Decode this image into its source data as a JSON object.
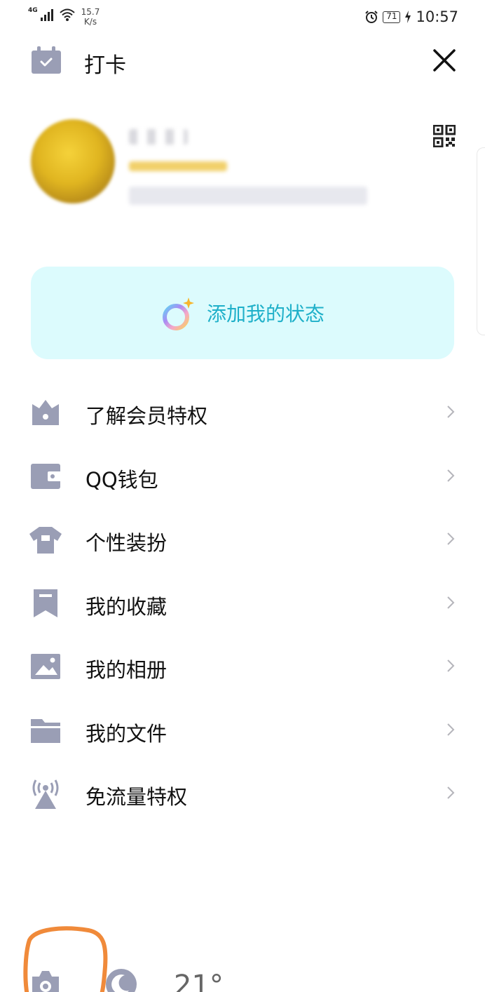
{
  "status_bar": {
    "network": "4G",
    "speed_value": "15.7",
    "speed_unit": "K/s",
    "battery": "71",
    "time": "10:57"
  },
  "header": {
    "title": "打卡"
  },
  "status_card": {
    "label": "添加我的状态"
  },
  "menu": {
    "items": [
      {
        "label": "了解会员特权",
        "icon": "crown-icon"
      },
      {
        "label": "QQ钱包",
        "icon": "wallet-icon"
      },
      {
        "label": "个性装扮",
        "icon": "shirt-icon"
      },
      {
        "label": "我的收藏",
        "icon": "bookmark-icon"
      },
      {
        "label": "我的相册",
        "icon": "photo-icon"
      },
      {
        "label": "我的文件",
        "icon": "folder-icon"
      },
      {
        "label": "免流量特权",
        "icon": "signal-tower-icon"
      }
    ]
  },
  "bottom": {
    "temperature": "21°"
  },
  "colors": {
    "icon": "#9a9eb5",
    "status_card_bg": "#dcfbfd",
    "status_text": "#1fb0c9",
    "highlight": "#f08a3a"
  }
}
